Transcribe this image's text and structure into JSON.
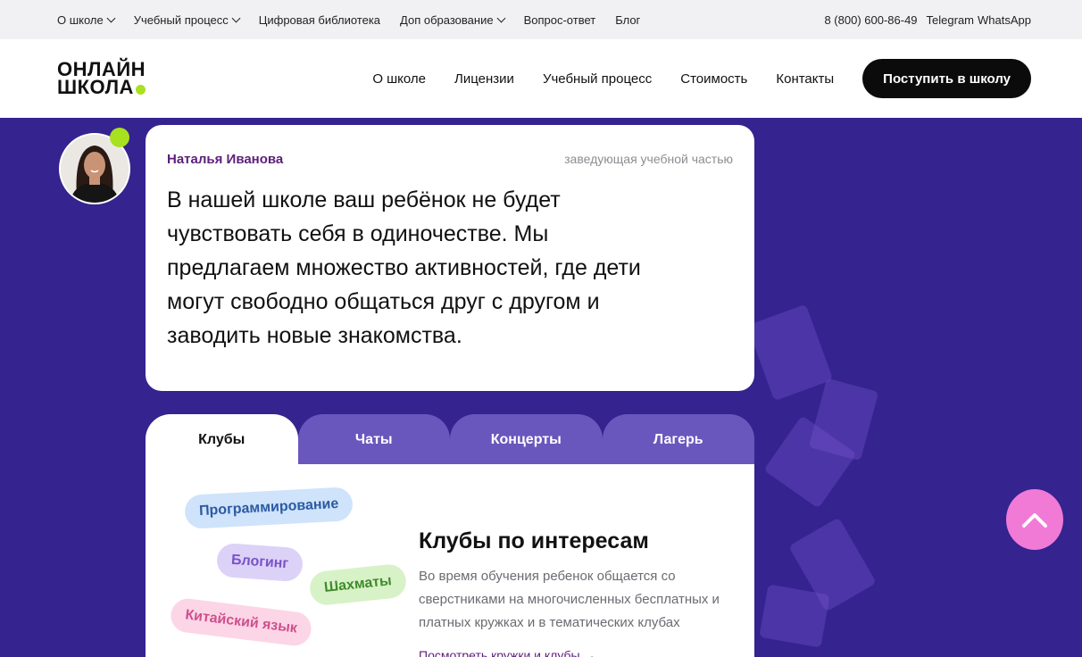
{
  "topbar": {
    "items": [
      {
        "label": "О школе",
        "dropdown": true
      },
      {
        "label": "Учебный процесс",
        "dropdown": true
      },
      {
        "label": "Цифровая библиотека",
        "dropdown": false
      },
      {
        "label": "Доп образование",
        "dropdown": true
      },
      {
        "label": "Вопрос-ответ",
        "dropdown": false
      },
      {
        "label": "Блог",
        "dropdown": false
      }
    ],
    "phone": "8 (800) 600-86-49",
    "telegram": "Telegram",
    "whatsapp": "WhatsApp"
  },
  "header": {
    "logo_line1": "ОНЛАЙН",
    "logo_line2": "ШКОЛА",
    "nav": [
      "О школе",
      "Лицензии",
      "Учебный процесс",
      "Стоимость",
      "Контакты"
    ],
    "cta_label": "Поступить в школу"
  },
  "quote": {
    "name": "Наталья Иванова",
    "role": "заведующая учебной частью",
    "text": "В нашей школе ваш ребёнок не будет чувствовать себя в одиночестве. Мы предлагаем множество активностей, где дети могут свободно общаться друг с другом и заводить новые знакомства."
  },
  "tabs": [
    {
      "label": "Клубы",
      "active": true
    },
    {
      "label": "Чаты",
      "active": false
    },
    {
      "label": "Концерты",
      "active": false
    },
    {
      "label": "Лагерь",
      "active": false
    }
  ],
  "panel": {
    "chips": [
      "Программирование",
      "Блогинг",
      "Шахматы",
      "Китайский язык"
    ],
    "title": "Клубы по интересам",
    "description": "Во время обучения ребенок общается со сверстниками на многочисленных бесплатных и платных кружках и в тематических клубах",
    "link": "Посмотреть кружки и клубы →"
  },
  "colors": {
    "background": "#35238f",
    "accent_green": "#a7e11f",
    "tab_inactive": "#6a57bd",
    "scroll_button": "#f07ad6",
    "name_color": "#5c1f7a"
  },
  "icons": {
    "dropdown": "chevron-down-icon",
    "scroll_top": "chevron-up-icon"
  }
}
